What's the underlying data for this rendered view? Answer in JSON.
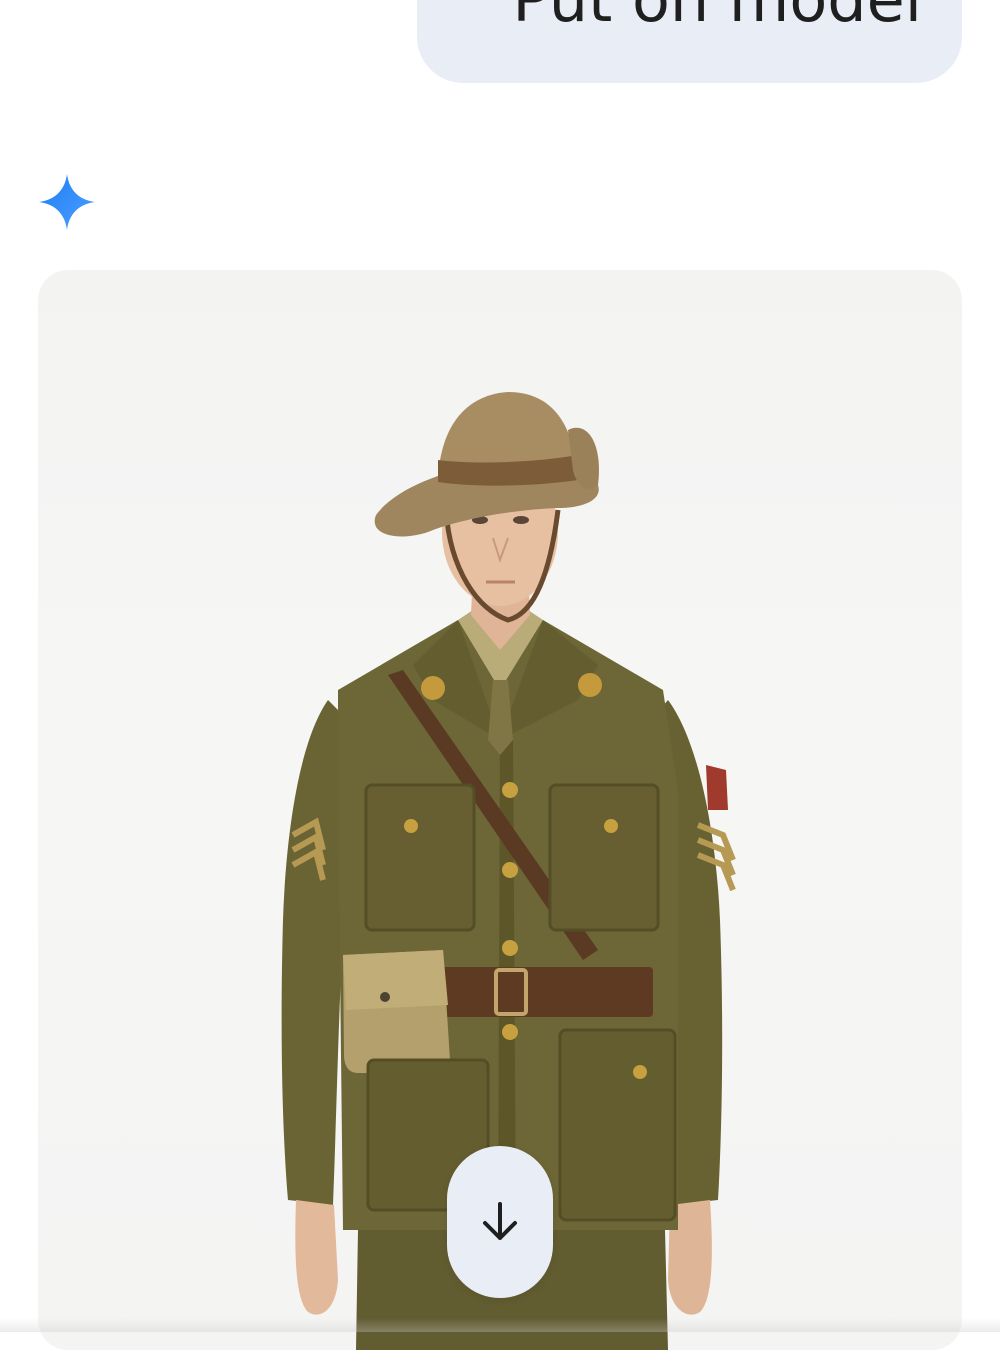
{
  "conversation": {
    "user_message": "Put on model",
    "assistant_icon": "gemini-spark-icon",
    "generated_image": {
      "subject": "soldier-in-olive-service-uniform"
    },
    "scroll_button_icon": "arrow-down-icon"
  },
  "colors": {
    "user_bubble_bg": "#e9eef6",
    "spark_blue": "#4285f4",
    "uniform_olive": "#6b6434"
  }
}
